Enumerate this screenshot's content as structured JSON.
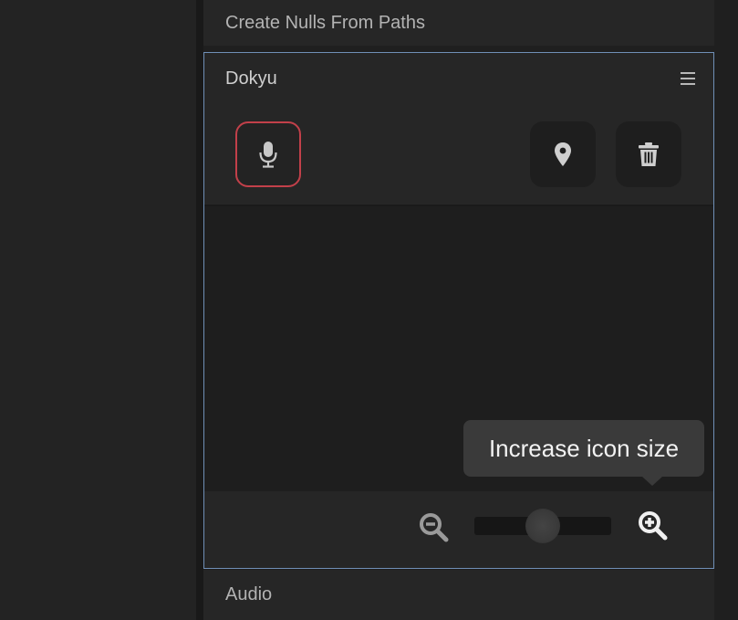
{
  "panels": {
    "create_nulls_title": "Create Nulls From Paths",
    "audio_title": "Audio"
  },
  "dokyu": {
    "title": "Dokyu",
    "menu_icon": "hamburger-menu-icon",
    "toolbar": [
      {
        "name": "microphone-button",
        "icon": "microphone-icon",
        "selected": true
      },
      {
        "name": "location-pin-button",
        "icon": "location-pin-icon",
        "selected": false
      },
      {
        "name": "delete-button",
        "icon": "trash-icon",
        "selected": false
      }
    ],
    "tooltip": "Increase icon size",
    "zoom": {
      "out_icon": "zoom-out-icon",
      "in_icon": "zoom-in-icon",
      "slider_level": 0.5
    }
  },
  "colors": {
    "selection_border": "#c2404a",
    "panel_focus_border": "#6f8fb6",
    "tooltip_bg": "#3a3a3a"
  }
}
